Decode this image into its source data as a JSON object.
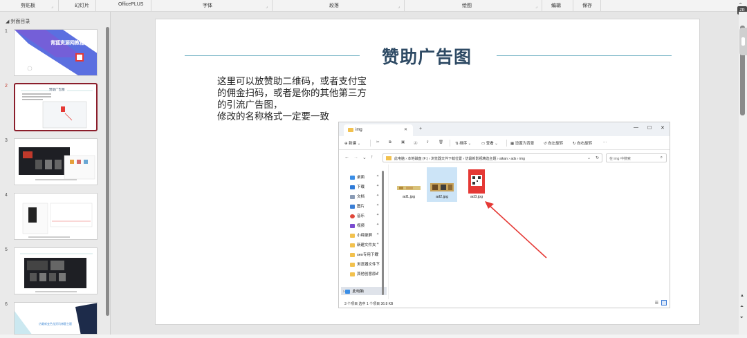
{
  "ribbon": {
    "groups": [
      "剪贴板",
      "幻灯片",
      "OfficePLUS",
      "字体",
      "段落",
      "绘图",
      "编辑",
      "保存"
    ],
    "collapse_icon": "chevron-up-icon"
  },
  "outline": {
    "header": "封面目录",
    "slides": [
      {
        "number": "1",
        "title": "青狐资源网教程"
      },
      {
        "number": "2",
        "title": "赞助广告图",
        "active": true
      },
      {
        "number": "3"
      },
      {
        "number": "4"
      },
      {
        "number": "5"
      },
      {
        "number": "6",
        "title": "仿最新变色龙资讯博客主题"
      }
    ]
  },
  "slide": {
    "title": "赞助广告图",
    "body_lines": [
      "这里可以放赞助二维码，或者支付宝",
      "的佣金扫码，或者是你的其他第三方",
      "的引流广告图，",
      "修改的名称格式一定要一致"
    ]
  },
  "explorer": {
    "tab_title": "img",
    "new_tab": "+",
    "window_buttons": [
      "—",
      "☐",
      "✕"
    ],
    "toolbar": [
      "新建",
      "排序",
      "查看",
      "设置为背景",
      "向左旋转",
      "向右旋转",
      "···"
    ],
    "address_path": "此电脑  ›  本地磁盘 (F:)  ›  浏览器文件下载位置  ›  仿最新影视精选主题  ›  aikan  ›  ads  ›  img",
    "search_placeholder": "在 img 中搜索",
    "nav_items": [
      {
        "label": "桌面",
        "color": "#3a8ee6"
      },
      {
        "label": "下载",
        "color": "#2f7bd8"
      },
      {
        "label": "文档",
        "color": "#8a9bb5"
      },
      {
        "label": "图片",
        "color": "#3b7fd6"
      },
      {
        "label": "音乐",
        "color": "#e0473a"
      },
      {
        "label": "视频",
        "color": "#7a4bd0"
      },
      {
        "label": "小绵录屏",
        "color": "#f2c14e"
      },
      {
        "label": "新建文件夹",
        "color": "#f2c14e"
      },
      {
        "label": "seo专用下载",
        "color": "#f2c14e"
      },
      {
        "label": "浏览器文件下",
        "color": "#f2c14e"
      },
      {
        "label": "其他创意原d",
        "color": "#f2c14e"
      }
    ],
    "this_pc": "此电脑",
    "files": [
      {
        "name": "ad1.jpg",
        "selected": false
      },
      {
        "name": "ad2.jpg",
        "selected": true
      },
      {
        "name": "ad3.jpg",
        "selected": false
      }
    ],
    "status": "3 个项目    选中 1 个项目  36.8 KB",
    "accent": "#e53935"
  }
}
